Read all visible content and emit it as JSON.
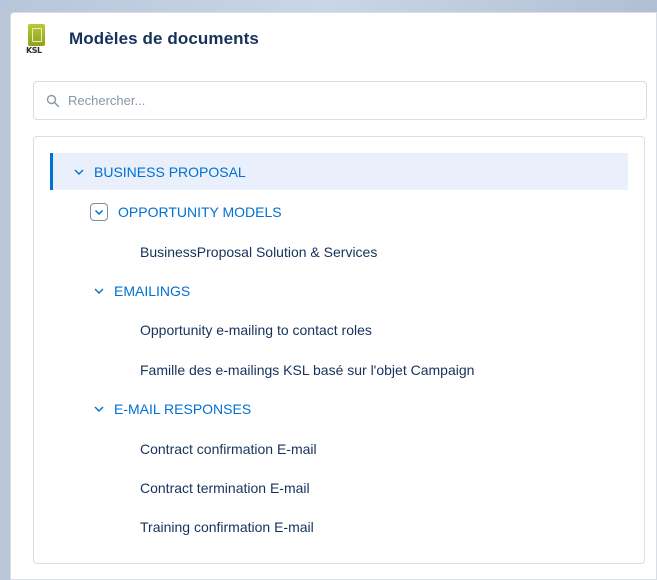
{
  "header": {
    "title": "Modèles de documents",
    "logo_text": "KSL"
  },
  "search": {
    "placeholder": "Rechercher..."
  },
  "tree": {
    "root": {
      "label": "BUSINESS PROPOSAL",
      "expanded": true,
      "selected": true
    },
    "groups": [
      {
        "label": "OPPORTUNITY MODELS",
        "expanded": true,
        "focused": true,
        "items": [
          "BusinessProposal Solution & Services"
        ]
      },
      {
        "label": "EMAILINGS",
        "expanded": true,
        "items": [
          "Opportunity e-mailing to contact roles",
          "Famille des e-mailings KSL basé sur l'objet Campaign"
        ]
      },
      {
        "label": "E-MAIL RESPONSES",
        "expanded": true,
        "items": [
          "Contract confirmation E-mail",
          "Contract termination E-mail",
          "Training confirmation E-mail"
        ]
      }
    ]
  },
  "colors": {
    "accent": "#0070d2",
    "text_dark": "#16325c",
    "selected_bg": "#e9f0fb",
    "border": "#d8dde6",
    "logo_green": "#9fb32a"
  }
}
